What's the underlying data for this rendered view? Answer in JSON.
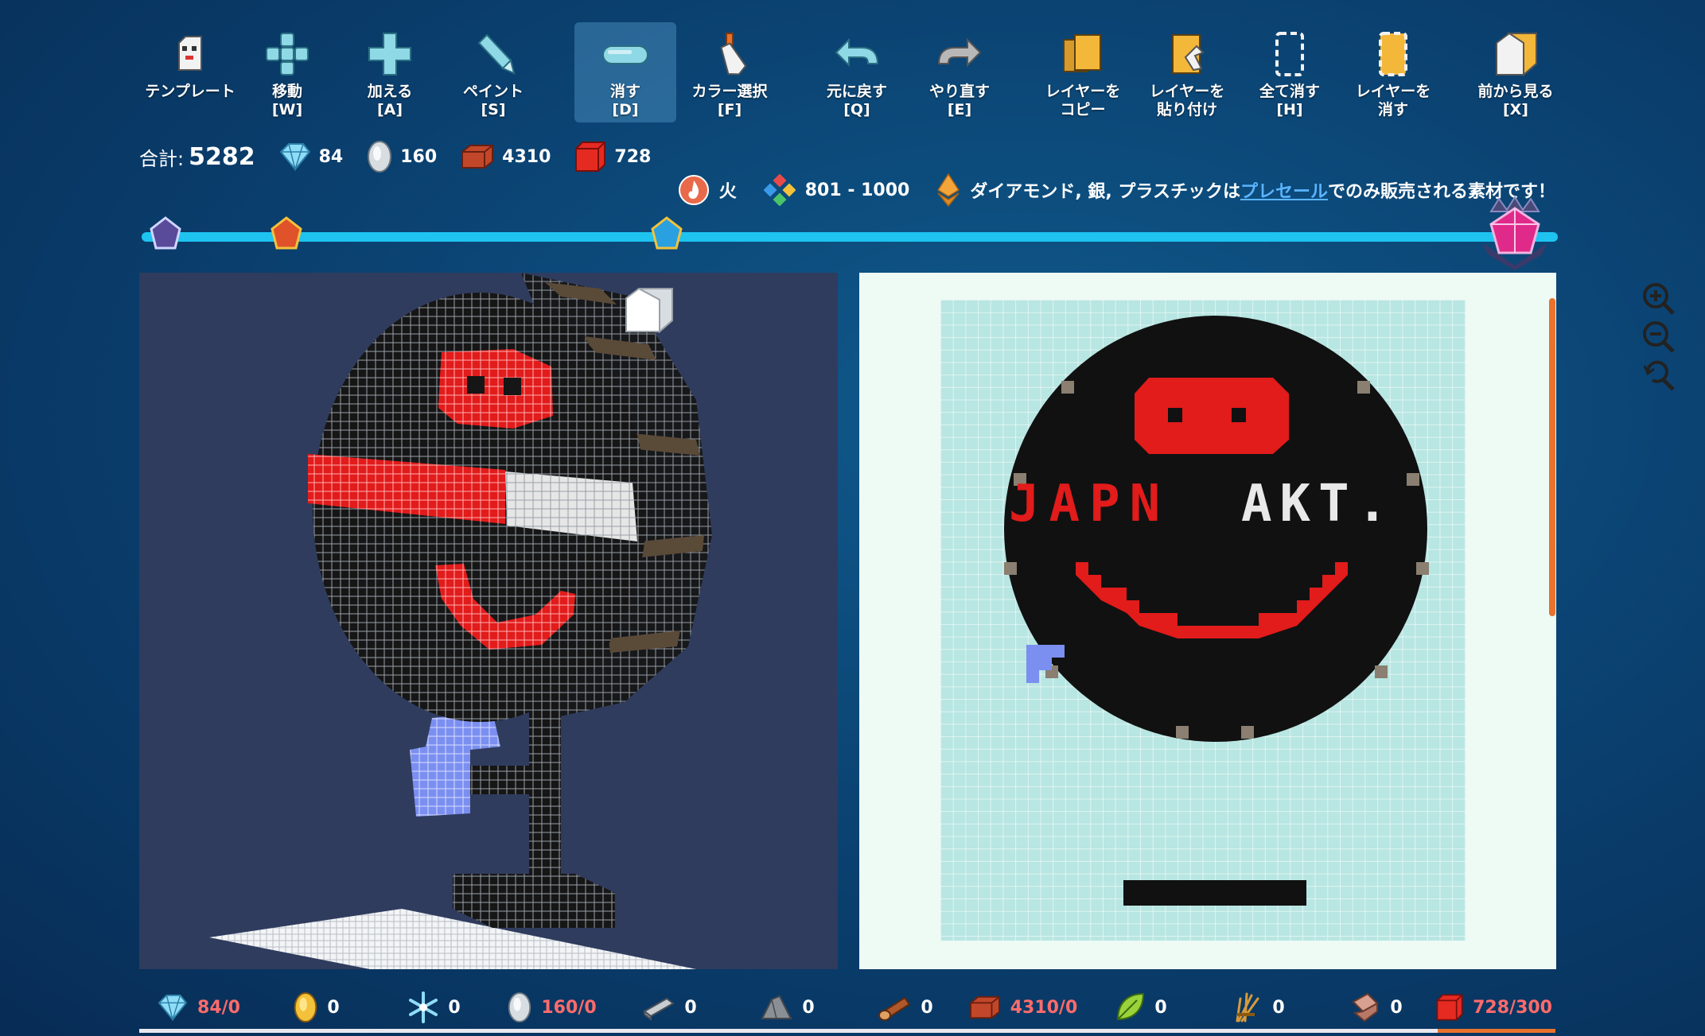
{
  "toolbar": {
    "tools": [
      {
        "label": "テンプレート",
        "icon": "template-icon"
      },
      {
        "label": "移動\n[W]",
        "icon": "move-icon"
      },
      {
        "label": "加える\n[A]",
        "icon": "add-icon"
      },
      {
        "label": "ペイント\n[S]",
        "icon": "paint-icon"
      },
      {
        "label": "消す\n[D]",
        "icon": "erase-icon",
        "active": true
      },
      {
        "label": "カラー選択\n[F]",
        "icon": "color-picker-icon"
      },
      {
        "label": "元に戻す\n[Q]",
        "icon": "undo-icon"
      },
      {
        "label": "やり直す\n[E]",
        "icon": "redo-icon"
      },
      {
        "label": "レイヤーを\nコピー",
        "icon": "copy-layer-icon"
      },
      {
        "label": "レイヤーを\n貼り付け",
        "icon": "paste-layer-icon"
      },
      {
        "label": "全て消す\n[H]",
        "icon": "clear-all-icon"
      },
      {
        "label": "レイヤーを\n消す",
        "icon": "clear-layer-icon"
      },
      {
        "label": "前から見る\n[X]",
        "icon": "front-view-icon"
      }
    ]
  },
  "stats": {
    "total_label": "合計:",
    "total_value": "5282",
    "diamond": "84",
    "silver": "160",
    "brick": "4310",
    "plastic": "728"
  },
  "info": {
    "element": "火",
    "range": "801 - 1000",
    "notice_prefix": "ダイアモンド, 銀, プラスチックは",
    "notice_link": "プレセール",
    "notice_suffix": "でのみ販売される素材です！"
  },
  "materials": [
    {
      "name": "diamond",
      "icon": "diamond-icon",
      "value": "84/0",
      "over": true
    },
    {
      "name": "gold",
      "icon": "gold-icon",
      "value": "0",
      "over": false
    },
    {
      "name": "ice",
      "icon": "snowflake-icon",
      "value": "0",
      "over": false
    },
    {
      "name": "silver",
      "icon": "silver-icon",
      "value": "160/0",
      "over": true
    },
    {
      "name": "metal",
      "icon": "metal-bar-icon",
      "value": "0",
      "over": false
    },
    {
      "name": "stone",
      "icon": "stone-icon",
      "value": "0",
      "over": false
    },
    {
      "name": "wood",
      "icon": "wood-log-icon",
      "value": "0",
      "over": false
    },
    {
      "name": "brick",
      "icon": "brick-icon",
      "value": "4310/0",
      "over": true
    },
    {
      "name": "leaf",
      "icon": "leaf-icon",
      "value": "0",
      "over": false
    },
    {
      "name": "straw",
      "icon": "straw-icon",
      "value": "0",
      "over": false
    },
    {
      "name": "paper",
      "icon": "paper-icon",
      "value": "0",
      "over": false
    },
    {
      "name": "plastic",
      "icon": "plastic-cube-icon",
      "value": "728/300",
      "over": true
    }
  ],
  "canvas_text": {
    "left_letters": "JAPN",
    "right_letters": "AKT."
  },
  "colors": {
    "accent": "#1ec3f0",
    "red_pixel": "#e21b1b",
    "black_pixel": "#111111",
    "white_pixel": "#e8e8e8",
    "blue_pixel": "#7b8ff0"
  }
}
